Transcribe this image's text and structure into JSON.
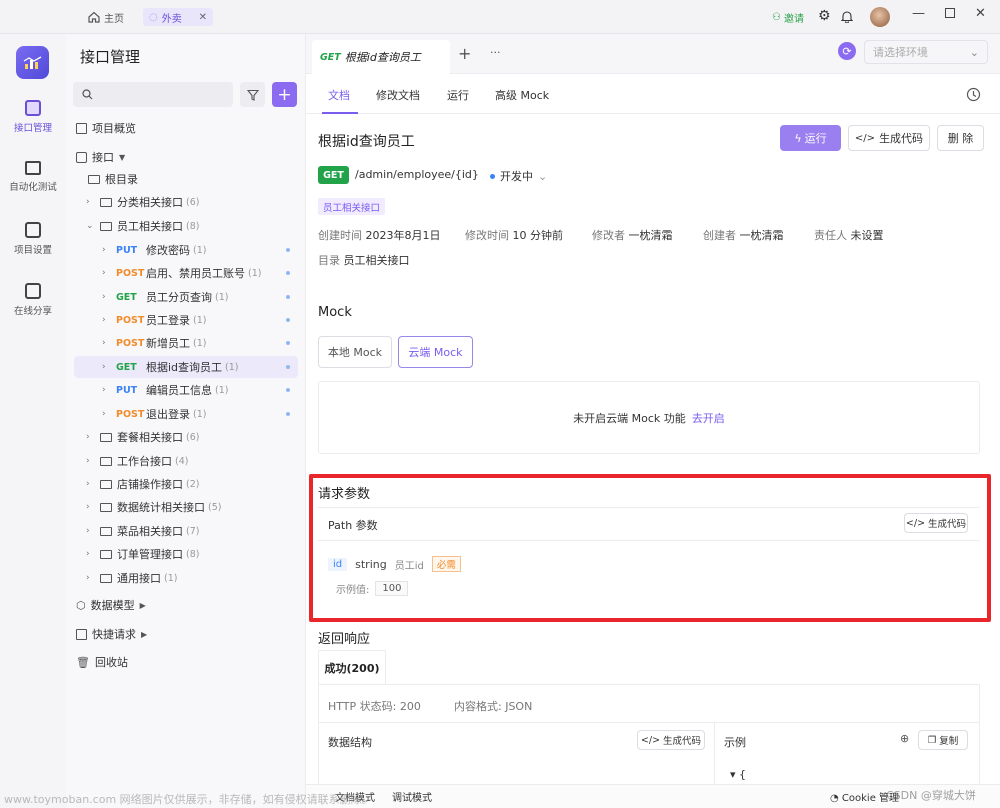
{
  "titlebar": {
    "tabs": [
      {
        "label": "主页",
        "icon": "home-icon"
      },
      {
        "label": "外卖",
        "icon": "project-icon"
      }
    ],
    "invite": "邀请"
  },
  "rail": {
    "items": [
      {
        "label": "接口管理",
        "icon": "api-icon"
      },
      {
        "label": "自动化测试",
        "icon": "automation-icon"
      },
      {
        "label": "项目设置",
        "icon": "settings-icon"
      },
      {
        "label": "在线分享",
        "icon": "share-icon"
      }
    ]
  },
  "sidebar": {
    "title": "接口管理",
    "search_placeholder": "",
    "overview": "项目概览",
    "api_root": "接口",
    "root_dir": "根目录",
    "folders_top": [
      {
        "label": "分类相关接口",
        "count": "(6)"
      },
      {
        "label": "员工相关接口",
        "count": "(8)"
      }
    ],
    "endpoints": [
      {
        "method": "PUT",
        "name": "修改密码",
        "count": "(1)"
      },
      {
        "method": "POST",
        "name": "启用、禁用员工账号",
        "count": "(1)"
      },
      {
        "method": "GET",
        "name": "员工分页查询",
        "count": "(1)"
      },
      {
        "method": "POST",
        "name": "员工登录",
        "count": "(1)"
      },
      {
        "method": "POST",
        "name": "新增员工",
        "count": "(1)"
      },
      {
        "method": "GET",
        "name": "根据id查询员工",
        "count": "(1)"
      },
      {
        "method": "PUT",
        "name": "编辑员工信息",
        "count": "(1)"
      },
      {
        "method": "POST",
        "name": "退出登录",
        "count": "(1)"
      }
    ],
    "folders_bottom": [
      {
        "label": "套餐相关接口",
        "count": "(6)"
      },
      {
        "label": "工作台接口",
        "count": "(4)"
      },
      {
        "label": "店铺操作接口",
        "count": "(2)"
      },
      {
        "label": "数据统计相关接口",
        "count": "(5)"
      },
      {
        "label": "菜品相关接口",
        "count": "(7)"
      },
      {
        "label": "订单管理接口",
        "count": "(8)"
      },
      {
        "label": "通用接口",
        "count": "(1)"
      }
    ],
    "data_model": "数据模型",
    "quick_request": "快捷请求",
    "recycle": "回收站"
  },
  "main": {
    "doc_tab": {
      "method": "GET",
      "name": "根据id查询员工"
    },
    "env_placeholder": "请选择环境",
    "subtabs": [
      "文档",
      "修改文档",
      "运行",
      "高级 Mock"
    ],
    "title": "根据id查询员工",
    "run": "运行",
    "gen_code": "生成代码",
    "delete": "删 除",
    "method": "GET",
    "path": "/admin/employee/{id}",
    "status": "开发中",
    "tag": "员工相关接口",
    "meta": {
      "created_label": "创建时间",
      "created": "2023年8月1日",
      "modified_label": "修改时间",
      "modified": "10 分钟前",
      "modifier_label": "修改者",
      "modifier": "一枕清霜",
      "creator_label": "创建者",
      "creator": "一枕清霜",
      "owner_label": "责任人",
      "owner": "未设置",
      "dir_label": "目录",
      "dir": "员工相关接口"
    },
    "mock": {
      "title": "Mock",
      "local": "本地 Mock",
      "cloud": "云端 Mock",
      "notice": "未开启云端 Mock 功能",
      "enable": "去开启"
    },
    "request": {
      "title": "请求参数",
      "path_params": "Path 参数",
      "gen_code": "生成代码",
      "param": {
        "name": "id",
        "type": "string",
        "desc": "员工id",
        "required": "必需",
        "example_label": "示例值:",
        "example": "100"
      }
    },
    "response": {
      "title": "返回响应",
      "tab": "成功(200)",
      "http_status": "HTTP 状态码: 200",
      "content_type": "内容格式: JSON",
      "schema": "数据结构",
      "gen_code": "生成代码",
      "example": "示例",
      "copy": "复制",
      "brace": "{"
    }
  },
  "bottombar": {
    "doc_mode": "文档模式",
    "debug_mode": "调试模式",
    "cookie": "Cookie 管理"
  },
  "watermark": "www.toymoban.com 网络图片仅供展示，非存储，如有侵权请联系删除。",
  "watermark_right": "CSDN @穿城大饼",
  "highlight_color": "#e8262b",
  "accent": "#8b6cf0"
}
